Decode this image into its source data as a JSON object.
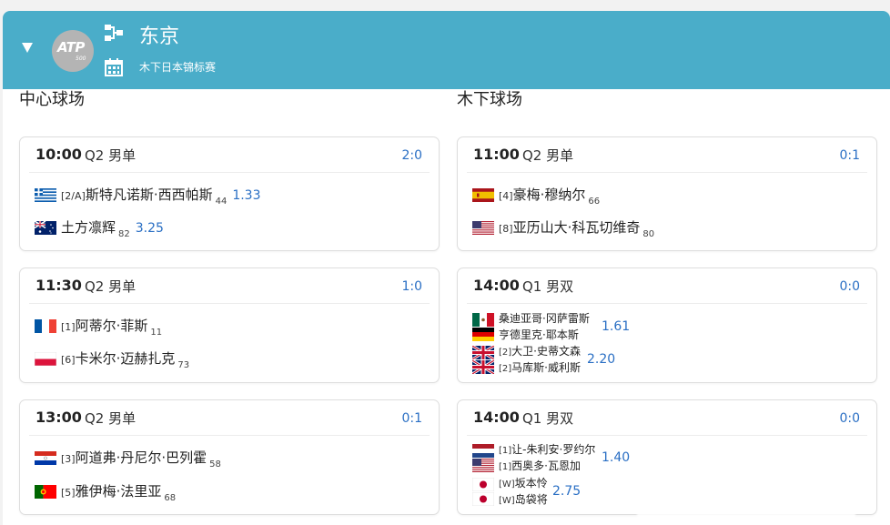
{
  "header": {
    "title": "东京",
    "subtitle": "木下日本锦标赛",
    "logo_text": "ATP",
    "logo_number": "500",
    "color": "#4aadc9"
  },
  "columns": [
    {
      "title": "中心球场",
      "matches": [
        {
          "time": "10:00",
          "round": "Q2 男单",
          "score": "2:0",
          "players": [
            {
              "flag": "greece",
              "seed": "[2/A]",
              "name": "斯特凡诺斯·西西帕斯",
              "rank": "44",
              "odds": "1.33"
            },
            {
              "flag": "australia",
              "seed": "",
              "name": "土方凛辉",
              "rank": "82",
              "odds": "3.25"
            }
          ]
        },
        {
          "time": "11:30",
          "round": "Q2 男单",
          "score": "1:0",
          "players": [
            {
              "flag": "france",
              "seed": "[1]",
              "name": "阿蒂尔·菲斯",
              "rank": "11",
              "odds": ""
            },
            {
              "flag": "poland",
              "seed": "[6]",
              "name": "卡米尔·迈赫扎克",
              "rank": "73",
              "odds": ""
            }
          ]
        },
        {
          "time": "13:00",
          "round": "Q2 男单",
          "score": "0:1",
          "players": [
            {
              "flag": "paraguay",
              "seed": "[3]",
              "name": "阿道弗·丹尼尔·巴列霍",
              "rank": "58",
              "odds": ""
            },
            {
              "flag": "portugal",
              "seed": "[5]",
              "name": "雅伊梅·法里亚",
              "rank": "68",
              "odds": ""
            }
          ]
        }
      ]
    },
    {
      "title": "木下球场",
      "matches": [
        {
          "time": "11:00",
          "round": "Q2 男单",
          "score": "0:1",
          "players": [
            {
              "flag": "spain",
              "seed": "[4]",
              "name": "豪梅·穆纳尔",
              "rank": "66",
              "odds": ""
            },
            {
              "flag": "usa",
              "seed": "[8]",
              "name": "亚历山大·科瓦切维奇",
              "rank": "80",
              "odds": ""
            }
          ]
        },
        {
          "time": "14:00",
          "round": "Q1 男双",
          "score": "0:0",
          "teams": [
            {
              "flags": [
                "mexico",
                "germany"
              ],
              "names": [
                {
                  "seed": "",
                  "name": "桑迪亚哥·冈萨雷斯"
                },
                {
                  "seed": "",
                  "name": "亨德里克·耶本斯"
                }
              ],
              "odds": "1.61"
            },
            {
              "flags": [
                "uk",
                "uk"
              ],
              "names": [
                {
                  "seed": "[2]",
                  "name": "大卫·史蒂文森"
                },
                {
                  "seed": "[2]",
                  "name": "马库斯·威利斯"
                }
              ],
              "odds": "2.20"
            }
          ]
        },
        {
          "time": "14:00",
          "round": "Q1 男双",
          "score": "0:0",
          "teams": [
            {
              "flags": [
                "netherlands",
                "usa"
              ],
              "names": [
                {
                  "seed": "[1]",
                  "name": "让-朱利安·罗约尔"
                },
                {
                  "seed": "[1]",
                  "name": "西奥多·瓦恩加"
                }
              ],
              "odds": "1.40"
            },
            {
              "flags": [
                "japan",
                "japan"
              ],
              "names": [
                {
                  "seed": "[W]",
                  "name": "坂本怜"
                },
                {
                  "seed": "[W]",
                  "name": "岛袋将"
                }
              ],
              "odds": "2.75"
            }
          ]
        }
      ]
    }
  ],
  "colors": {
    "accent": "#4aadc9",
    "link": "#2a6fc4"
  }
}
